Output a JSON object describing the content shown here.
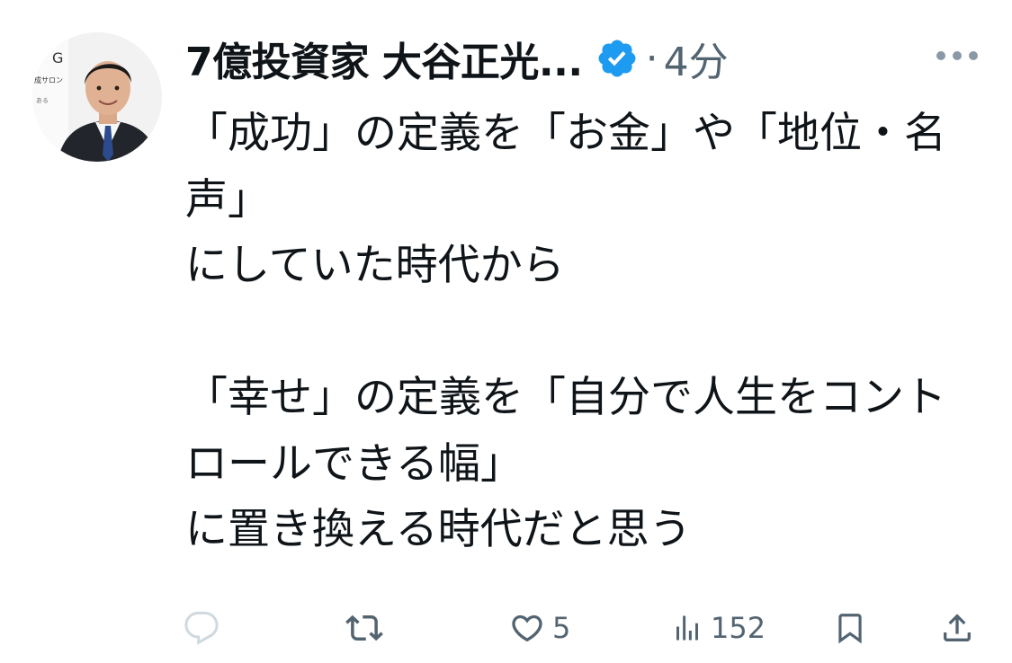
{
  "tweet": {
    "display_name": "7億投資家 大谷正光...",
    "separator": "·",
    "timestamp": "4分",
    "avatar_text_top": "G",
    "avatar_text_mid": "成サロン",
    "avatar_text_low": "ある",
    "text": "「成功」の定義を「お金」や「地位・名声」\nにしていた時代から\n\n「幸せ」の定義を「自分で人生をコントロールできる幅」\nに置き換える時代だと思う",
    "icons": {
      "verified": "verified-badge-icon",
      "more": "more-horizontal-icon",
      "reply": "reply-icon",
      "retweet": "retweet-icon",
      "like": "heart-icon",
      "views": "views-bar-chart-icon",
      "bookmark": "bookmark-icon",
      "share": "share-icon"
    },
    "verified_color": "#1d9bf0"
  },
  "actions": {
    "reply_count": "",
    "retweet_count": "",
    "like_count": "5",
    "views_count": "152"
  }
}
